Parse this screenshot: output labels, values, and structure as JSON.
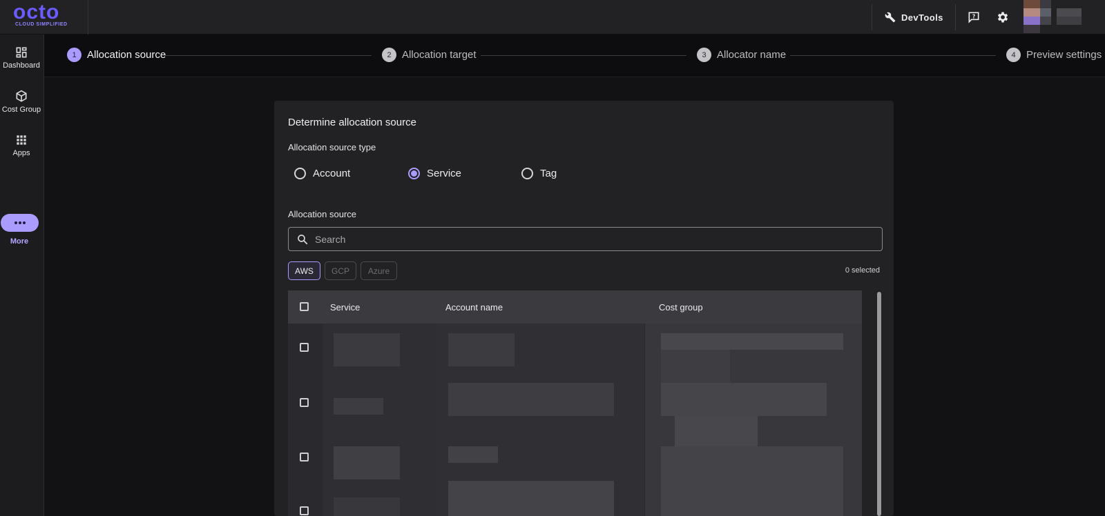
{
  "brand": {
    "name": "octo",
    "tagline": "CLOUD SIMPLIFIED"
  },
  "topbar": {
    "devtools_label": "DevTools",
    "icons": [
      "wrench-icon",
      "help-chat-icon",
      "settings-gear-icon"
    ]
  },
  "sidebar": {
    "items": [
      {
        "label": "Dashboard",
        "icon": "dashboard-grid-icon"
      },
      {
        "label": "Cost Group",
        "icon": "cube-icon"
      },
      {
        "label": "Apps",
        "icon": "apps-grid-icon"
      },
      {
        "label": "More",
        "icon": "more-dots-icon",
        "active": true
      }
    ]
  },
  "stepper": {
    "steps": [
      {
        "number": "1",
        "label": "Allocation source",
        "active": true
      },
      {
        "number": "2",
        "label": "Allocation target",
        "active": false
      },
      {
        "number": "3",
        "label": "Allocator name",
        "active": false
      },
      {
        "number": "4",
        "label": "Preview settings",
        "active": false
      }
    ]
  },
  "form": {
    "title": "Determine allocation source",
    "source_type_label": "Allocation source type",
    "source_types": [
      {
        "label": "Account",
        "checked": false
      },
      {
        "label": "Service",
        "checked": true
      },
      {
        "label": "Tag",
        "checked": false
      }
    ],
    "source_label": "Allocation source",
    "search": {
      "placeholder": "Search",
      "value": ""
    },
    "providers": [
      {
        "label": "AWS",
        "selected": true
      },
      {
        "label": "GCP",
        "selected": false
      },
      {
        "label": "Azure",
        "selected": false
      }
    ],
    "selected_count": "0 selected",
    "table": {
      "columns": [
        "Service",
        "Account name",
        "Cost group"
      ],
      "rows": [
        {
          "checked": false
        },
        {
          "checked": false
        },
        {
          "checked": false
        },
        {
          "checked": false
        }
      ]
    }
  },
  "colors": {
    "accent": "#a99bff",
    "brand": "#6a5cff",
    "background": "#121214",
    "card": "#222225"
  }
}
